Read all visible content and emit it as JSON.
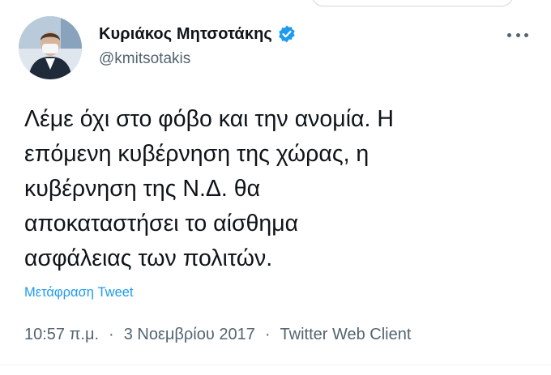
{
  "tweet": {
    "author_name": "Κυριάκος Μητσοτάκης",
    "handle": "@kmitsotakis",
    "text": "Λέμε όχι στο φόβο και την ανομία. Η\nεπόμενη κυβέρνηση της χώρας, η\nκυβέρνηση της Ν.Δ. θα\nαποκαταστήσει το αίσθημα\nασφάλειας των πολιτών.",
    "translate_label": "Μετάφραση Tweet",
    "time": "10:57 π.μ.",
    "date": "3 Νοεμβρίου 2017",
    "client": "Twitter Web Client",
    "separator": "·"
  },
  "icons": {
    "verified": "verified-badge-icon",
    "more": "more-options-icon",
    "avatar": "profile-avatar"
  },
  "colors": {
    "link": "#1d9bf0",
    "secondary_text": "#536471",
    "verified": "#1d9bf0"
  }
}
